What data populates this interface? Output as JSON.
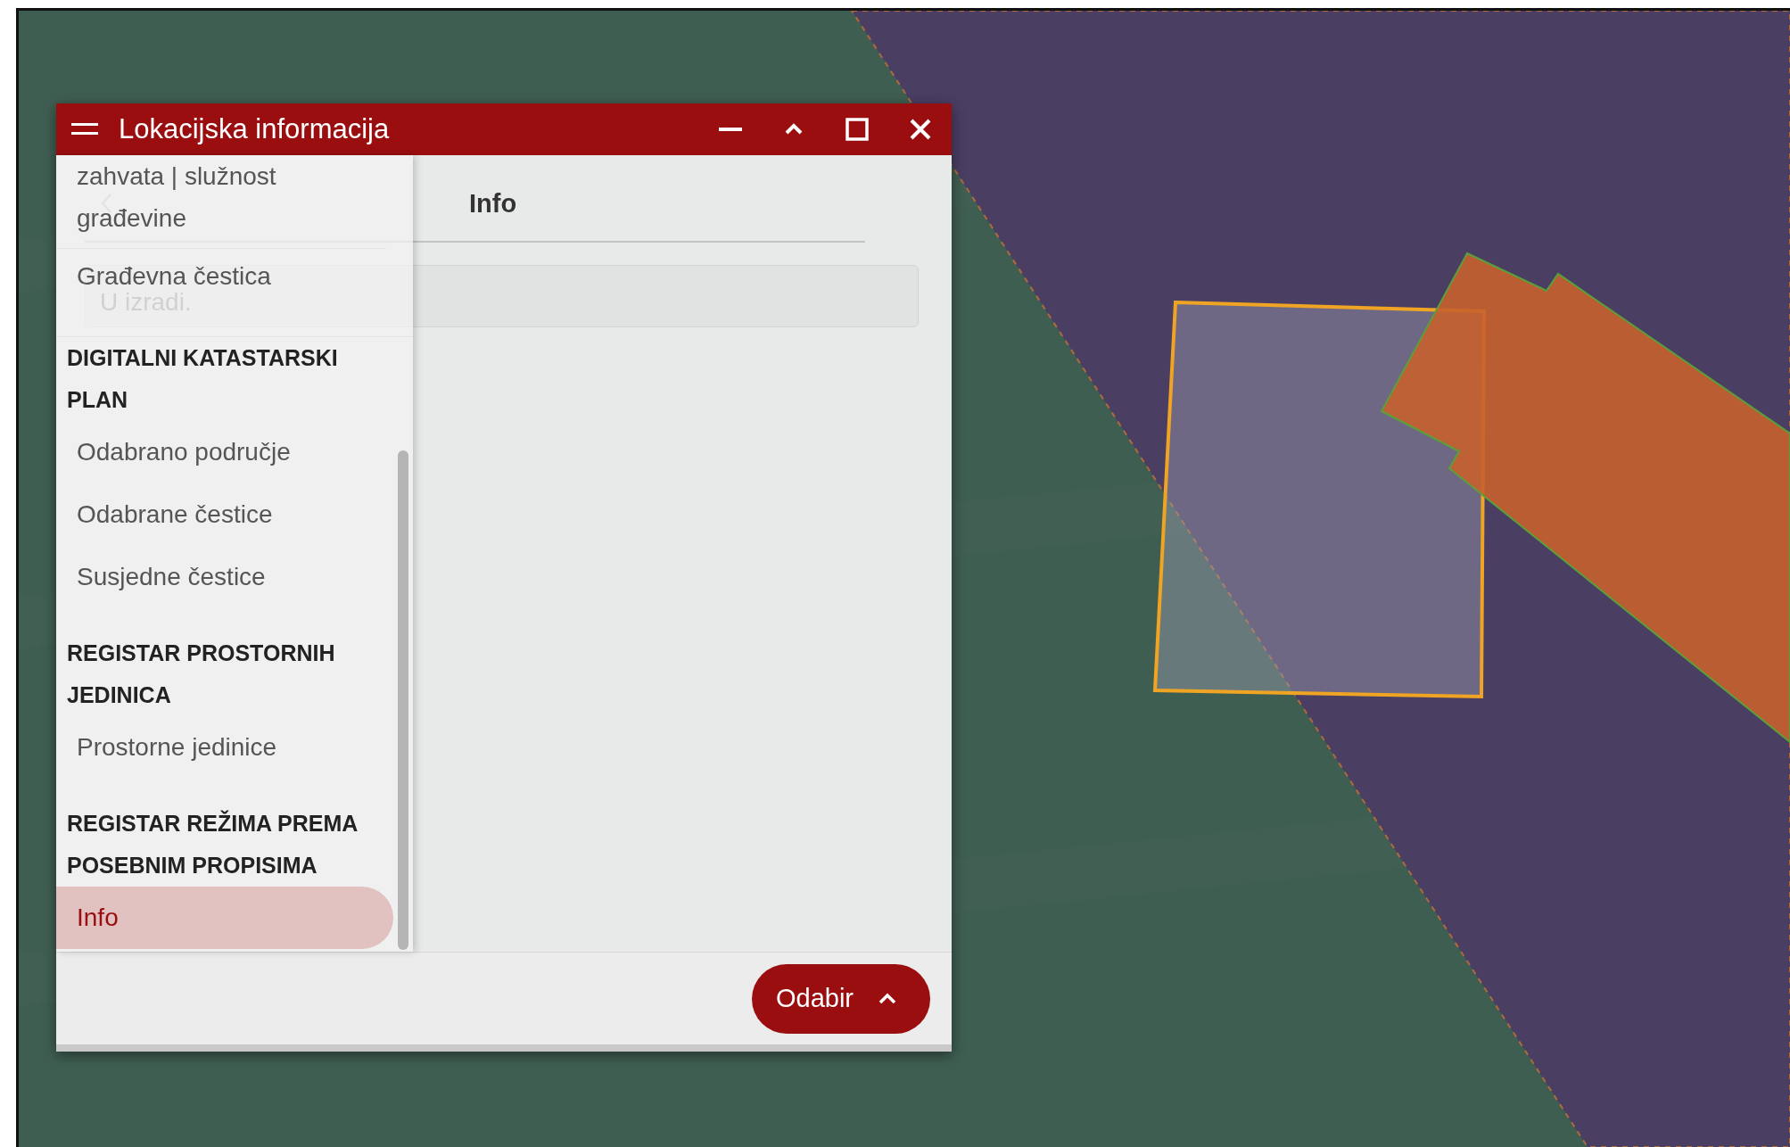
{
  "window": {
    "title": "Lokacijska informacija"
  },
  "panel": {
    "tab": "Info",
    "field": {
      "value": "U izradi."
    }
  },
  "sidebar": {
    "sections": [
      {
        "items": [
          {
            "label": "zahvata | služnost građevine",
            "selected": false
          },
          {
            "label": "Građevna čestica",
            "selected": false
          }
        ]
      },
      {
        "heading": "DIGITALNI KATASTARSKI PLAN",
        "items": [
          {
            "label": "Odabrano područje",
            "selected": false
          },
          {
            "label": "Odabrane čestice",
            "selected": false
          },
          {
            "label": "Susjedne čestice",
            "selected": false
          }
        ]
      },
      {
        "heading": "REGISTAR PROSTORNIH JEDINICA",
        "items": [
          {
            "label": "Prostorne jedinice",
            "selected": false
          }
        ]
      },
      {
        "heading": "REGISTAR REŽIMA PREMA POSEBNIM PROPISIMA",
        "items": [
          {
            "label": "Info",
            "selected": true
          }
        ]
      }
    ]
  },
  "footer": {
    "button": "Odabir"
  }
}
